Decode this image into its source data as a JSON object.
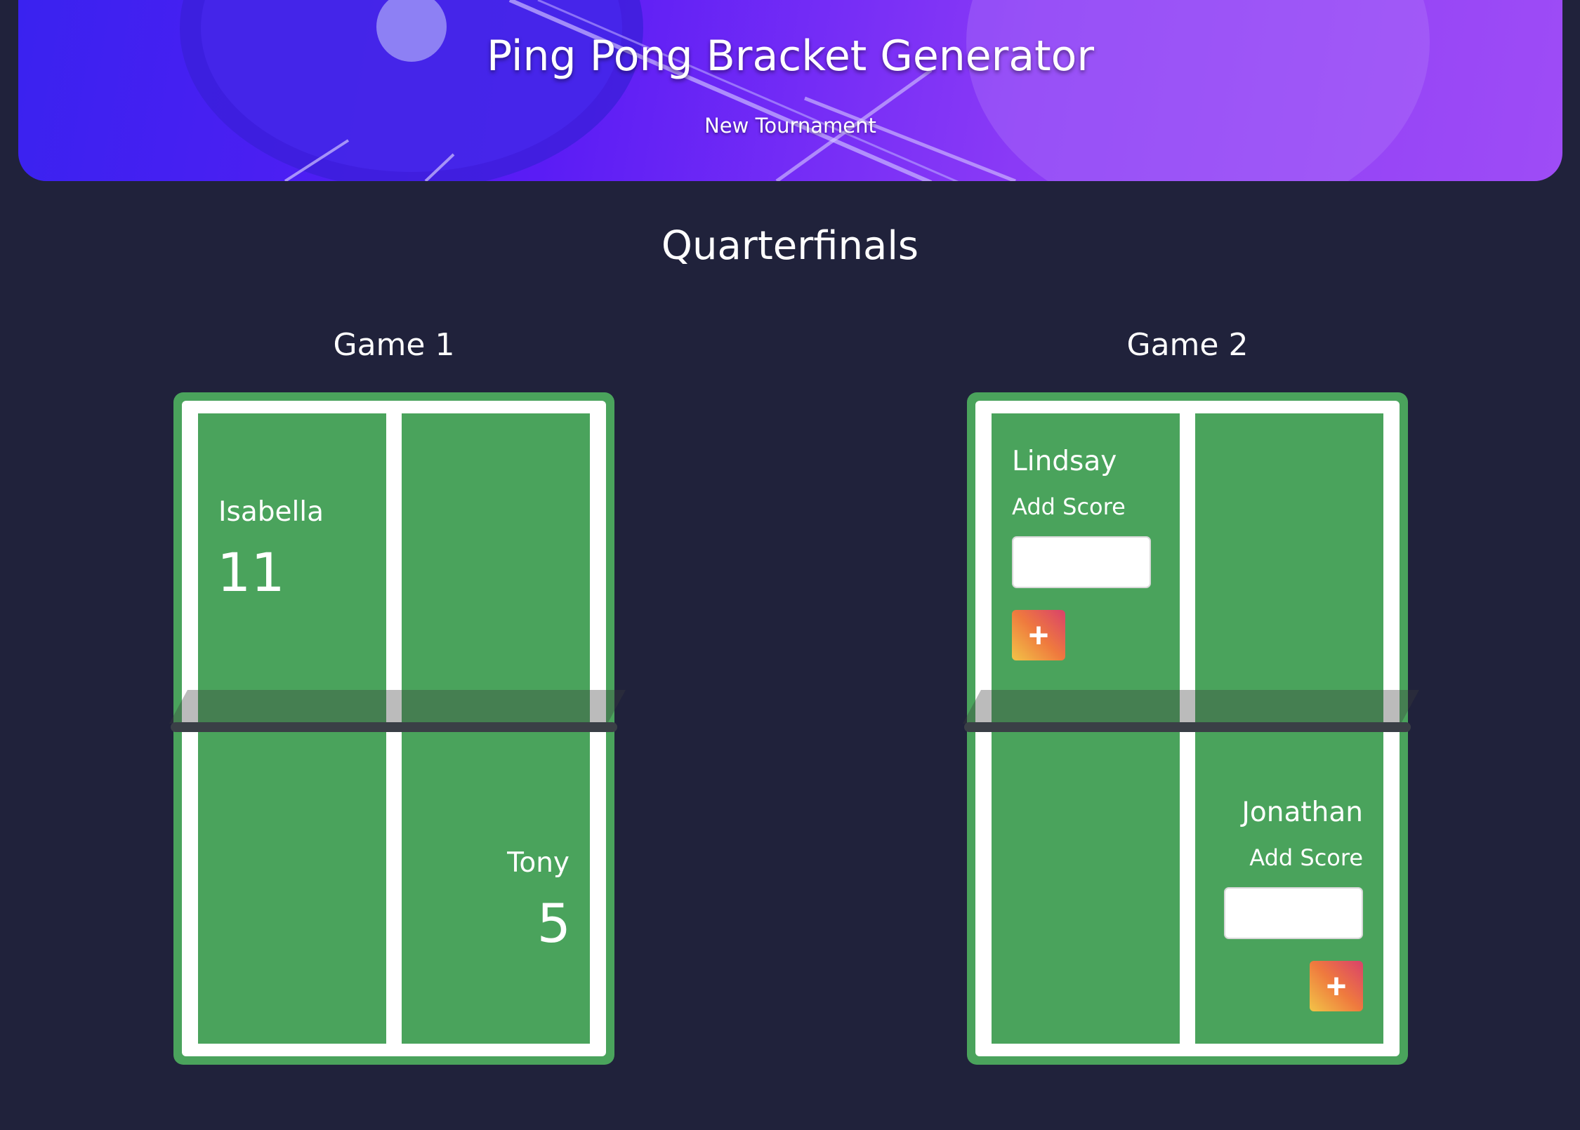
{
  "header": {
    "title": "Ping Pong Bracket Generator",
    "new_tournament_label": "New Tournament"
  },
  "round": {
    "title": "Quarterfinals"
  },
  "games": [
    {
      "title": "Game 1",
      "player1": {
        "name": "Isabella",
        "score": "11"
      },
      "player2": {
        "name": "Tony",
        "score": "5"
      }
    },
    {
      "title": "Game 2",
      "player1": {
        "name": "Lindsay",
        "add_score_label": "Add Score",
        "input_value": "",
        "button_label": "+"
      },
      "player2": {
        "name": "Jonathan",
        "add_score_label": "Add Score",
        "input_value": "",
        "button_label": "+"
      }
    }
  ],
  "colors": {
    "background": "#20223b",
    "table_green": "#4aa35c",
    "hero_gradient_start": "#3a22f0",
    "hero_gradient_end": "#9e4cf6"
  }
}
